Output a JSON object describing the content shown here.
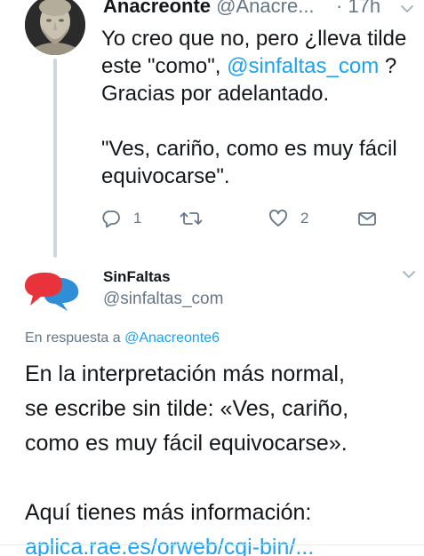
{
  "parent_tweet": {
    "display_name": "Anacreonte",
    "handle": "@Anacre...",
    "time": "· 17h",
    "text_line_1": "Yo creo que no, pero ¿lleva tilde",
    "text_line_2_pre": "este \"como\", ",
    "mention": "@sinfaltas_com",
    "text_line_2_post": " ?",
    "text_line_3": "Gracias por adelantado.",
    "text_line_4": "\"Ves, cariño, como es muy fácil",
    "text_line_5": "equivocarse\".",
    "reply_count": "1",
    "like_count": "2",
    "icons": {
      "reply": "reply-icon",
      "retweet": "retweet-icon",
      "like": "heart-icon",
      "dm": "envelope-icon",
      "more": "chevron-down-icon"
    }
  },
  "reply_tweet": {
    "display_name": "SinFaltas",
    "handle": "@sinfaltas_com",
    "replying_prefix": "En respuesta a ",
    "replying_to": "@Anacreonte6",
    "text_line_1": "En la interpretación más normal,",
    "text_line_2": "se escribe sin tilde: «Ves, cariño,",
    "text_line_3": "como es muy fácil equivocarse».",
    "text_line_4": "Aquí tienes más información:",
    "link": "aplica.rae.es/orweb/cgi-bin/...",
    "icons": {
      "avatar": "speech-bubbles-logo-icon",
      "more": "chevron-down-icon"
    }
  },
  "colors": {
    "link_blue": "#1da1f2",
    "muted_gray": "#657786",
    "text_dark": "#14171a",
    "thread_line": "#ccd6dd",
    "logo_red": "#e8333d",
    "logo_blue": "#2f8fd6"
  }
}
